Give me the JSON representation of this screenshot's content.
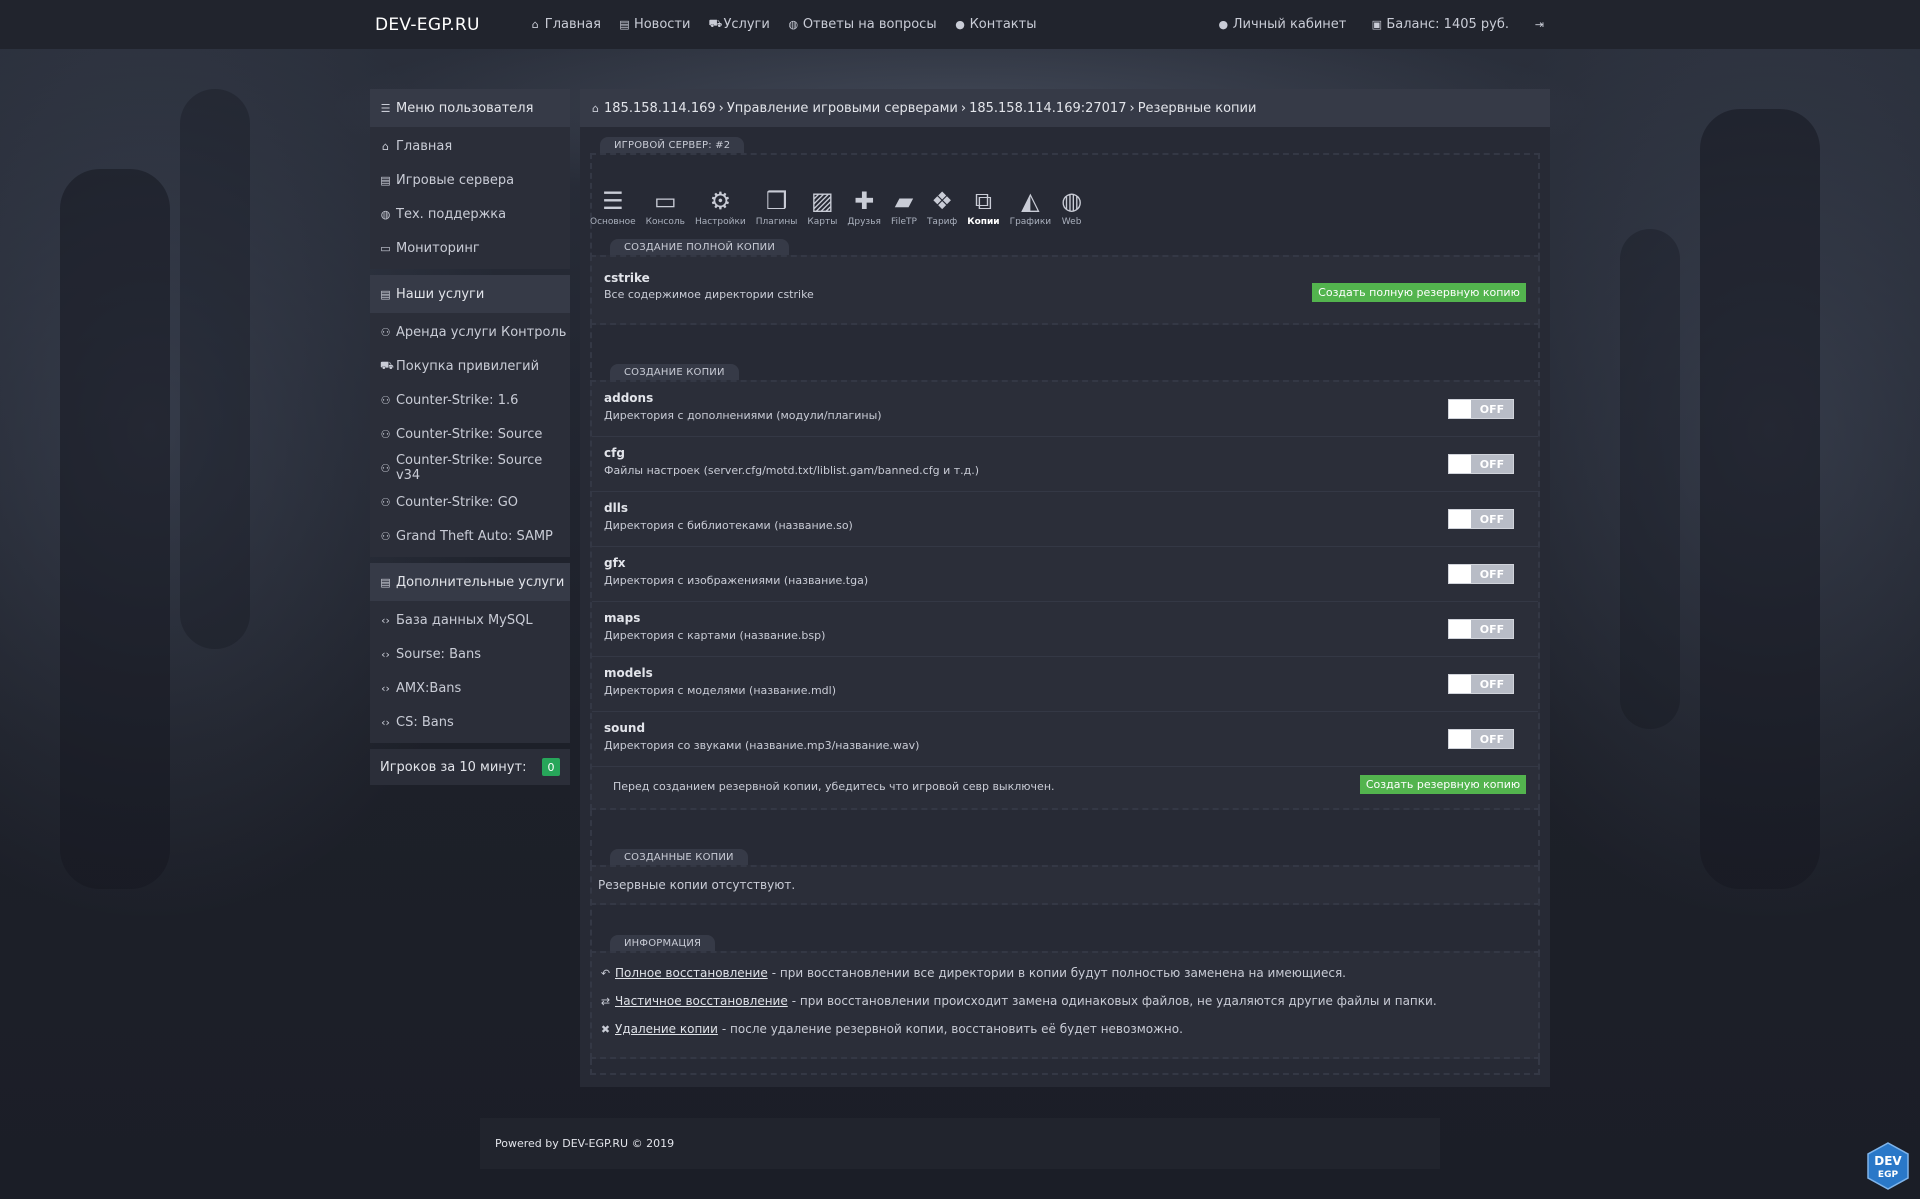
{
  "brand": "DEV-EGP.RU",
  "topnav": [
    {
      "icon": "home-icon",
      "glyph": "⌂",
      "label": "Главная"
    },
    {
      "icon": "newspaper-icon",
      "glyph": "▤",
      "label": "Новости"
    },
    {
      "icon": "cart-icon",
      "glyph": "🛒",
      "label": "Услуги"
    },
    {
      "icon": "globe-icon",
      "glyph": "◍",
      "label": "Ответы на вопросы"
    },
    {
      "icon": "user-icon",
      "glyph": "◉",
      "label": "Контакты"
    }
  ],
  "rightnav": {
    "cabinet": "Личный кабинет",
    "balance": "Баланс: 1405 руб."
  },
  "sidebar": {
    "user_menu_title": "Меню пользователя",
    "user_menu": [
      "Главная",
      "Игровые сервера",
      "Тех. поддержка",
      "Мониторинг"
    ],
    "services_title": "Наши услуги",
    "services": [
      "Аренда услуги Контроль",
      "Покупка привилегий",
      "Counter-Strike: 1.6",
      "Counter-Strike: Source",
      "Counter-Strike: Source v34",
      "Counter-Strike: GO",
      "Grand Theft Auto: SAMP"
    ],
    "extra_title": "Дополнительные услуги",
    "extra": [
      "База данных MySQL",
      "Sourse: Bans",
      "AMX:Bans",
      "CS: Bans"
    ],
    "players_label": "Игроков за 10 минут:",
    "players_count": "0"
  },
  "breadcrumb": [
    "185.158.114.169",
    "Управление игровыми серверами",
    "185.158.114.169:27017",
    "Резервные копии"
  ],
  "server_legend": "ИГРОВОЙ СЕРВЕР: #2",
  "tools": [
    {
      "icon": "menu-icon",
      "glyph": "☰",
      "label": "Основное"
    },
    {
      "icon": "monitor-icon",
      "glyph": "🖵",
      "label": "Консоль"
    },
    {
      "icon": "gear-icon",
      "glyph": "⚙",
      "label": "Настройки"
    },
    {
      "icon": "cubes-icon",
      "glyph": "❒",
      "label": "Плагины"
    },
    {
      "icon": "image-icon",
      "glyph": "▨",
      "label": "Карты"
    },
    {
      "icon": "add-user-icon",
      "glyph": "👤",
      "label": "Друзья"
    },
    {
      "icon": "folder-icon",
      "glyph": "📂",
      "label": "FileTP"
    },
    {
      "icon": "dropbox-icon",
      "glyph": "❖",
      "label": "Тариф"
    },
    {
      "icon": "copy-icon",
      "glyph": "⧉",
      "label": "Копии"
    },
    {
      "icon": "area-chart-icon",
      "glyph": "◭",
      "label": "Графики"
    },
    {
      "icon": "globe-icon",
      "glyph": "◍",
      "label": "Web"
    }
  ],
  "full_copy": {
    "legend": "СОЗДАНИЕ ПОЛНОЙ КОПИИ",
    "name": "cstrike",
    "desc": "Все содержимое директории cstrike",
    "button": "Создать полную резервную копию"
  },
  "partial_copy": {
    "legend": "СОЗДАНИЕ КОПИИ",
    "items": [
      {
        "name": "addons",
        "desc": "Директория с дополнениями (модули/плагины)",
        "state": "OFF"
      },
      {
        "name": "cfg",
        "desc": "Файлы настроек (server.cfg/motd.txt/liblist.gam/banned.cfg и т.д.)",
        "state": "OFF"
      },
      {
        "name": "dlls",
        "desc": "Директория с библиотеками (название.so)",
        "state": "OFF"
      },
      {
        "name": "gfx",
        "desc": "Директория с изображениями (название.tga)",
        "state": "OFF"
      },
      {
        "name": "maps",
        "desc": "Директория с картами (название.bsp)",
        "state": "OFF"
      },
      {
        "name": "models",
        "desc": "Директория с моделями (название.mdl)",
        "state": "OFF"
      },
      {
        "name": "sound",
        "desc": "Директория со звуками (название.mp3/название.wav)",
        "state": "OFF"
      }
    ],
    "note": "Перед созданием резервной копии, убедитесь что игровой севр выключен.",
    "button": "Создать резервную копию"
  },
  "created": {
    "legend": "СОЗДАННЫЕ КОПИИ",
    "empty": "Резервные копии отсутствуют."
  },
  "info": {
    "legend": "ИНФОРМАЦИЯ",
    "lines": [
      {
        "icon": "reply-all-icon",
        "glyph": "↶",
        "link": "Полное восстановление",
        "text": " - при восстановлении все директории в копии будут полностью заменена на имеющиеся."
      },
      {
        "icon": "retweet-icon",
        "glyph": "⇄",
        "link": "Частичное восстановление",
        "text": " - при восстановлении происходит замена одинаковых файлов, не удаляются другие файлы и папки."
      },
      {
        "icon": "times-icon",
        "glyph": "✖",
        "link": "Удаление копии",
        "text": " - после удаление резервной копии, восстановить её будет невозможно."
      }
    ]
  },
  "footer": "Powered by DEV-EGP.RU © 2019",
  "devlogo": {
    "line1": "DEV",
    "line2": "EGP"
  },
  "colors": {
    "accent_green": "#53b44e",
    "badge_green": "#27a65a",
    "panel": "#272a35",
    "header": "#363a47"
  }
}
